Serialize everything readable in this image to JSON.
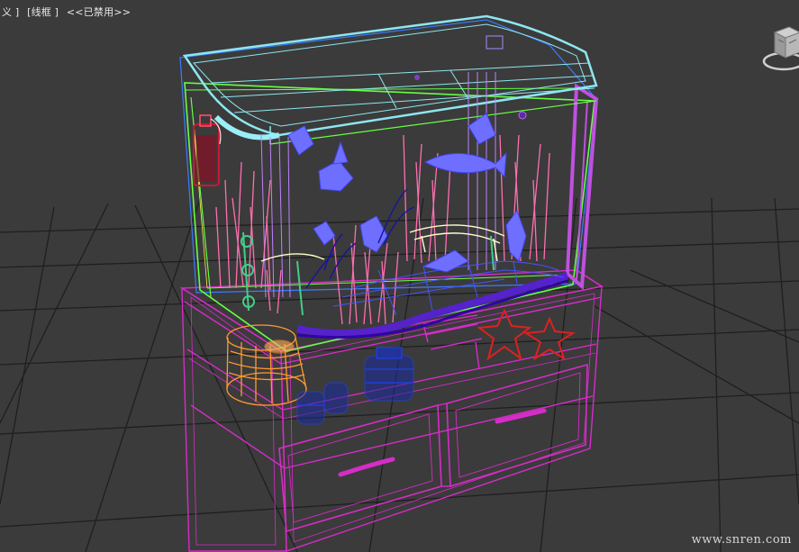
{
  "viewport": {
    "label_parts": [
      "义 ]",
      "[线框 ]",
      "<<已禁用>>"
    ],
    "shading_mode": "线框",
    "status": "<<已禁用>>"
  },
  "watermark": "www.snren.com",
  "colors": {
    "background": "#3b3b3b",
    "grid": "#1c1c1c",
    "cabinet": "#d62cc8",
    "tank_frame": "#66ff44",
    "lid": "#8ee6f0",
    "plants": "#ff6fb0",
    "fish": "#6f6fff",
    "basket": "#ff9a30",
    "jars": "#1f3fd8",
    "extinguisher": "#d01535",
    "starfish": "#e02020",
    "substrate": "#5522cc",
    "right_panel": "#c050e0"
  },
  "icons": [
    "viewcube-icon"
  ]
}
